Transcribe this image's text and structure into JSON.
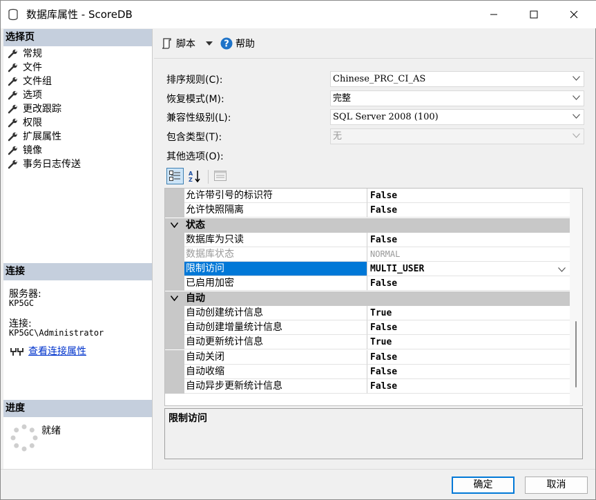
{
  "window": {
    "title": "数据库属性 - ScoreDB"
  },
  "left": {
    "select_page_header": "选择页",
    "pages": [
      {
        "label": "常规"
      },
      {
        "label": "文件"
      },
      {
        "label": "文件组"
      },
      {
        "label": "选项"
      },
      {
        "label": "更改跟踪"
      },
      {
        "label": "权限"
      },
      {
        "label": "扩展属性"
      },
      {
        "label": "镜像"
      },
      {
        "label": "事务日志传送"
      }
    ],
    "connection_header": "连接",
    "server_label": "服务器:",
    "server_value": "KP5GC",
    "connection_label": "连接:",
    "connection_value": "KP5GC\\Administrator",
    "view_connection_link": "查看连接属性",
    "progress_header": "进度",
    "progress_status": "就绪"
  },
  "toolbar": {
    "script_label": "脚本",
    "help_label": "帮助"
  },
  "form": {
    "collation_label": "排序规则(C):",
    "collation_value": "Chinese_PRC_CI_AS",
    "recovery_label": "恢复模式(M):",
    "recovery_value": "完整",
    "compat_label": "兼容性级别(L):",
    "compat_value": "SQL Server 2008 (100)",
    "containment_label": "包含类型(T):",
    "containment_value": "无",
    "other_options_label": "其他选项(O):"
  },
  "grid": {
    "rows": [
      {
        "name": "允许带引号的标识符",
        "value": "False"
      },
      {
        "name": "允许快照隔离",
        "value": "False"
      },
      {
        "category": "状态"
      },
      {
        "name": "数据库为只读",
        "value": "False"
      },
      {
        "name": "数据库状态",
        "value": "NORMAL"
      },
      {
        "name": "限制访问",
        "value": "MULTI_USER"
      },
      {
        "name": "已启用加密",
        "value": "False"
      },
      {
        "category": "自动"
      },
      {
        "name": "自动创建统计信息",
        "value": "True"
      },
      {
        "name": "自动创建增量统计信息",
        "value": "False"
      },
      {
        "name": "自动更新统计信息",
        "value": "True"
      },
      {
        "name": "自动关闭",
        "value": "False"
      },
      {
        "name": "自动收缩",
        "value": "False"
      },
      {
        "name": "自动异步更新统计信息",
        "value": "False"
      }
    ]
  },
  "description": {
    "title": "限制访问"
  },
  "buttons": {
    "ok": "确定",
    "cancel": "取消"
  },
  "colors": {
    "accent": "#0078d7",
    "section_header": "#c5cfdd",
    "category_row": "#c8c8c8"
  }
}
